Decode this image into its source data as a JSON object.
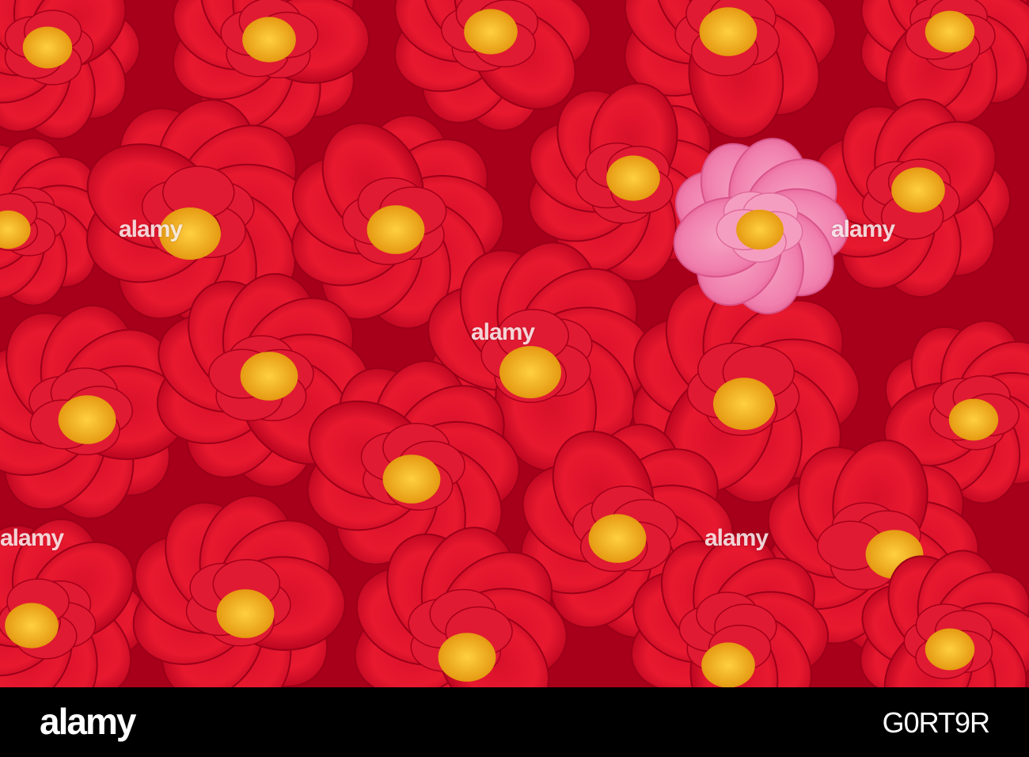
{
  "watermark": {
    "text": "alamy"
  },
  "footer": {
    "logo": "alamy",
    "image_id": "G0RT9R"
  },
  "colors": {
    "background_red": "#c8001e",
    "petal_red": "#e0142c",
    "pink_flower": "#f48cb4",
    "stamen_yellow": "#f2b01e",
    "footer_bg": "#000000"
  }
}
